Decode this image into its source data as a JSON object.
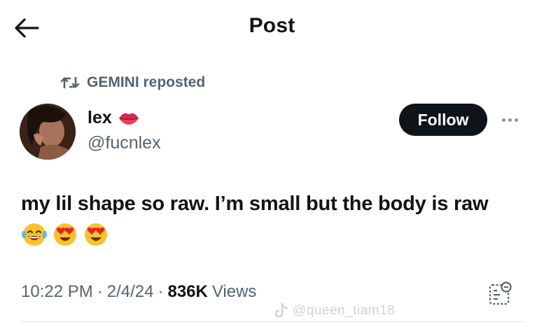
{
  "header": {
    "title": "Post",
    "back_icon": "arrow-left-icon"
  },
  "repost": {
    "icon": "retweet-icon",
    "label": "GEMINI reposted"
  },
  "author": {
    "name": "lex",
    "name_emoji": "lips-emoji",
    "handle": "@fucnlex",
    "avatar": "avatar-photo"
  },
  "actions": {
    "follow_label": "Follow",
    "more_icon": "more-options-icon"
  },
  "post": {
    "text": "my lil shape so raw. I’m small but the body is raw",
    "emojis": [
      "laughing-tears-emoji",
      "heart-eyes-emoji",
      "heart-eyes-emoji"
    ]
  },
  "meta": {
    "time": "10:22 PM",
    "separator": "·",
    "date": "2/4/24",
    "views_count": "836K",
    "views_label": "Views",
    "stats_icon": "post-analytics-icon"
  },
  "watermark": {
    "text": "@queen_tiam18",
    "icon": "tiktok-logo"
  },
  "colors": {
    "text_primary": "#0f1419",
    "text_secondary": "#536471",
    "follow_bg": "#0f1419",
    "follow_text": "#ffffff",
    "emoji_yellow": "#f8c22c",
    "heart_red": "#e0242e"
  }
}
